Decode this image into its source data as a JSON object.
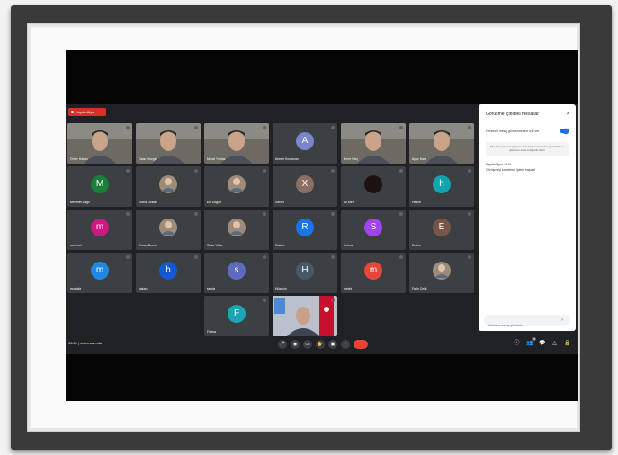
{
  "meeting": {
    "recording_label": "Kaydediliyor",
    "time_and_code": "13:01  |  odh-eswj-mfa"
  },
  "tiles": [
    {
      "name": "Ömer Hakan",
      "type": "video"
    },
    {
      "name": "Ozan Gezgin",
      "type": "video"
    },
    {
      "name": "Murat Yılmaz",
      "type": "video"
    },
    {
      "name": "Ahmet Kocaman",
      "type": "avatar",
      "initial": "A",
      "color": "#7986cb"
    },
    {
      "name": "Emre Kılıç",
      "type": "video"
    },
    {
      "name": "Ayşe Kara",
      "type": "video"
    },
    {
      "name": "Mehmet Dağlı",
      "type": "avatar",
      "initial": "M",
      "color": "#188038"
    },
    {
      "name": "Kübra Özkan",
      "type": "photo"
    },
    {
      "name": "Elif Doğan",
      "type": "photo"
    },
    {
      "name": "Xavier",
      "type": "avatar",
      "initial": "X",
      "color": "#8d6e63"
    },
    {
      "name": "Ali Mert",
      "type": "photo-dark"
    },
    {
      "name": "Hatice",
      "type": "avatar",
      "initial": "h",
      "color": "#12a4af"
    },
    {
      "name": "mehmet",
      "type": "avatar",
      "initial": "m",
      "color": "#d01884"
    },
    {
      "name": "Orhan Demir",
      "type": "photo"
    },
    {
      "name": "Seda Yıldız",
      "type": "photo"
    },
    {
      "name": "Rukiye",
      "type": "avatar",
      "initial": "R",
      "color": "#1a73e8"
    },
    {
      "name": "Selma",
      "type": "avatar",
      "initial": "S",
      "color": "#a142f4"
    },
    {
      "name": "Emine",
      "type": "avatar",
      "initial": "E",
      "color": "#795548"
    },
    {
      "name": "mustafa",
      "type": "avatar",
      "initial": "m",
      "color": "#1e88e5"
    },
    {
      "name": "hakan",
      "type": "avatar",
      "initial": "h",
      "color": "#1558d6"
    },
    {
      "name": "sevda",
      "type": "avatar",
      "initial": "s",
      "color": "#5c6bc0"
    },
    {
      "name": "Hüseyin",
      "type": "avatar",
      "initial": "H",
      "color": "#455a64"
    },
    {
      "name": "melek",
      "type": "avatar",
      "initial": "m",
      "color": "#e8453c"
    },
    {
      "name": "Fatih Çelik",
      "type": "photo"
    },
    {
      "name": "Fatma",
      "type": "avatar",
      "initial": "F",
      "color": "#1aa6b7"
    },
    {
      "name": "",
      "type": "video-flag"
    }
  ],
  "chat": {
    "title": "Görüşme içindeki mesajlar",
    "toggle_label": "Herkesin mesaj göndermesine izin ver",
    "info": "Mesajlar yalnızca görüşmedeki kişiler tarafından görülebilir ve görüşme sona erdiğinde silinir",
    "message_author": "Kaydediliyor  13:01",
    "message_text": "Görüşmeyi kaydetme işlemi başladı",
    "input_placeholder": "Herkese mesaj gönderin"
  },
  "controls": {
    "mic": "🎤",
    "camera": "◉",
    "captions": "CC",
    "hand": "✋",
    "present": "▣",
    "more": "⋮"
  },
  "right_icons": {
    "info": "ⓘ",
    "people": "👥",
    "people_count": "26",
    "chat": "💬",
    "activities": "△",
    "lock": "🔒"
  },
  "colors": {
    "meet_bg": "#202124",
    "tile_bg": "#3c4043",
    "hangup": "#ea4335",
    "accent": "#1a73e8"
  }
}
